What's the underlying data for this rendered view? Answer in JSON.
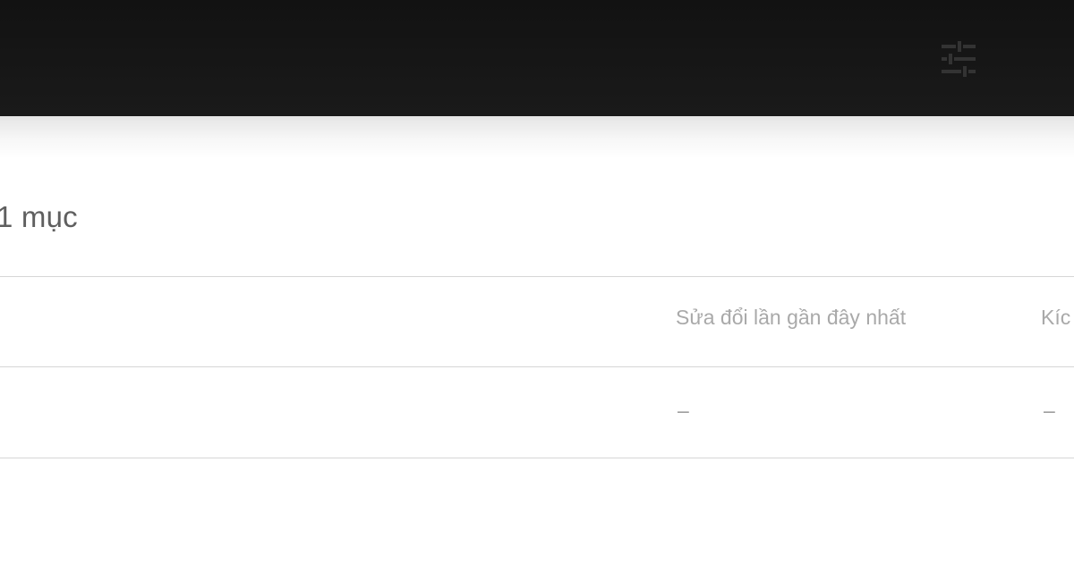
{
  "header": {
    "filter_icon": "sliders-filter-icon"
  },
  "summary": {
    "item_count": "1 mục"
  },
  "table": {
    "columns": [
      "Sửa đổi lần gần đây nhất",
      "Kíc"
    ],
    "rows": [
      {
        "cells": [
          "–",
          "–"
        ]
      }
    ]
  },
  "colors": {
    "topbar": "#121212",
    "divider": "#d6d6d6",
    "header_text": "#a9a9a9",
    "count_text": "#5f5f5f"
  }
}
